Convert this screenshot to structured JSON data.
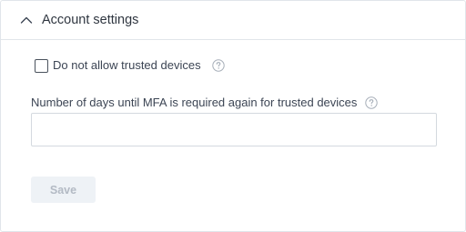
{
  "panel": {
    "title": "Account settings",
    "expanded": true,
    "chevron_icon": "chevron-up-icon"
  },
  "trusted_devices": {
    "checkbox_label": "Do not allow trusted devices",
    "checked": false,
    "help_icon": "question-circle-icon"
  },
  "mfa_days": {
    "label": "Number of days until MFA is required again for trusted devices",
    "value": "",
    "help_icon": "question-circle-icon"
  },
  "save_button": {
    "label": "Save",
    "disabled": true
  },
  "colors": {
    "border": "#e1e5ea",
    "text": "#3c4554",
    "help_icon": "#a7afb9",
    "button_disabled_bg": "#eef2f6",
    "button_disabled_text": "#b3bac4"
  }
}
